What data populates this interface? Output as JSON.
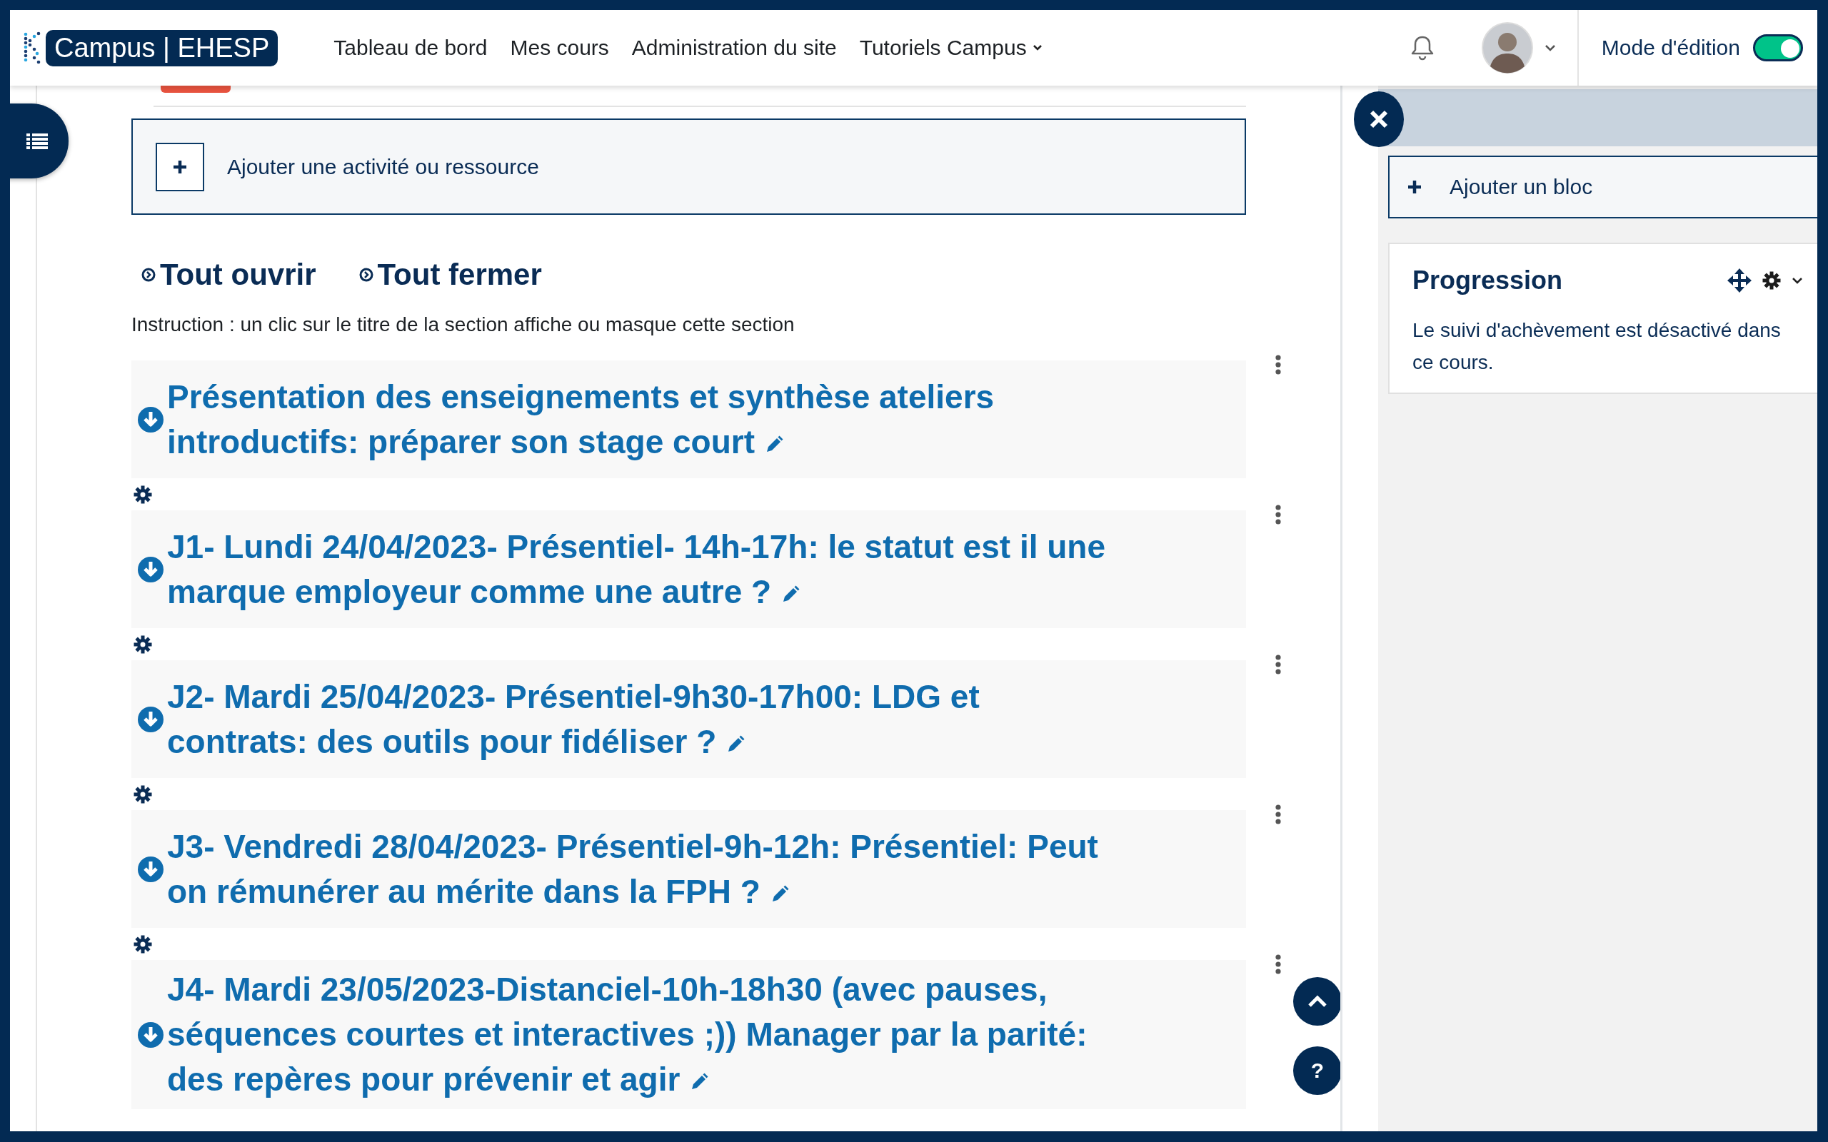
{
  "header": {
    "logo_text": "Campus | EHESP",
    "nav": [
      {
        "label": "Tableau de bord",
        "has_menu": false
      },
      {
        "label": "Mes cours",
        "has_menu": false
      },
      {
        "label": "Administration du site",
        "has_menu": false
      },
      {
        "label": "Tutoriels Campus",
        "has_menu": true
      }
    ],
    "edit_mode": {
      "label": "Mode d'édition",
      "on": true
    }
  },
  "course": {
    "add_activity": "Ajouter une activité ou ressource",
    "expand_all": "Tout ouvrir",
    "collapse_all": "Tout fermer",
    "instruction": "Instruction : un clic sur le titre de la section affiche ou masque cette section",
    "sections": [
      {
        "title": "Présentation des enseignements et synthèse ateliers introductifs: préparer son stage court"
      },
      {
        "title": "J1- Lundi 24/04/2023- Présentiel- 14h-17h: le statut est il une marque employeur comme une autre ?"
      },
      {
        "title": "J2- Mardi 25/04/2023- Présentiel-9h30-17h00: LDG et contrats: des outils pour fidéliser ?"
      },
      {
        "title": "J3- Vendredi 28/04/2023- Présentiel-9h-12h: Présentiel: Peut on rémunérer au mérite dans la FPH ?"
      },
      {
        "title": "J4- Mardi 23/05/2023-Distanciel-10h-18h30 (avec pauses, séquences courtes et interactives ;)) Manager par la parité: des repères pour prévenir et agir"
      }
    ]
  },
  "drawer": {
    "add_block": "Ajouter un bloc",
    "block": {
      "title": "Progression",
      "text": "Le suivi d'achèvement est désactivé dans ce cours."
    }
  },
  "help_button": "?"
}
